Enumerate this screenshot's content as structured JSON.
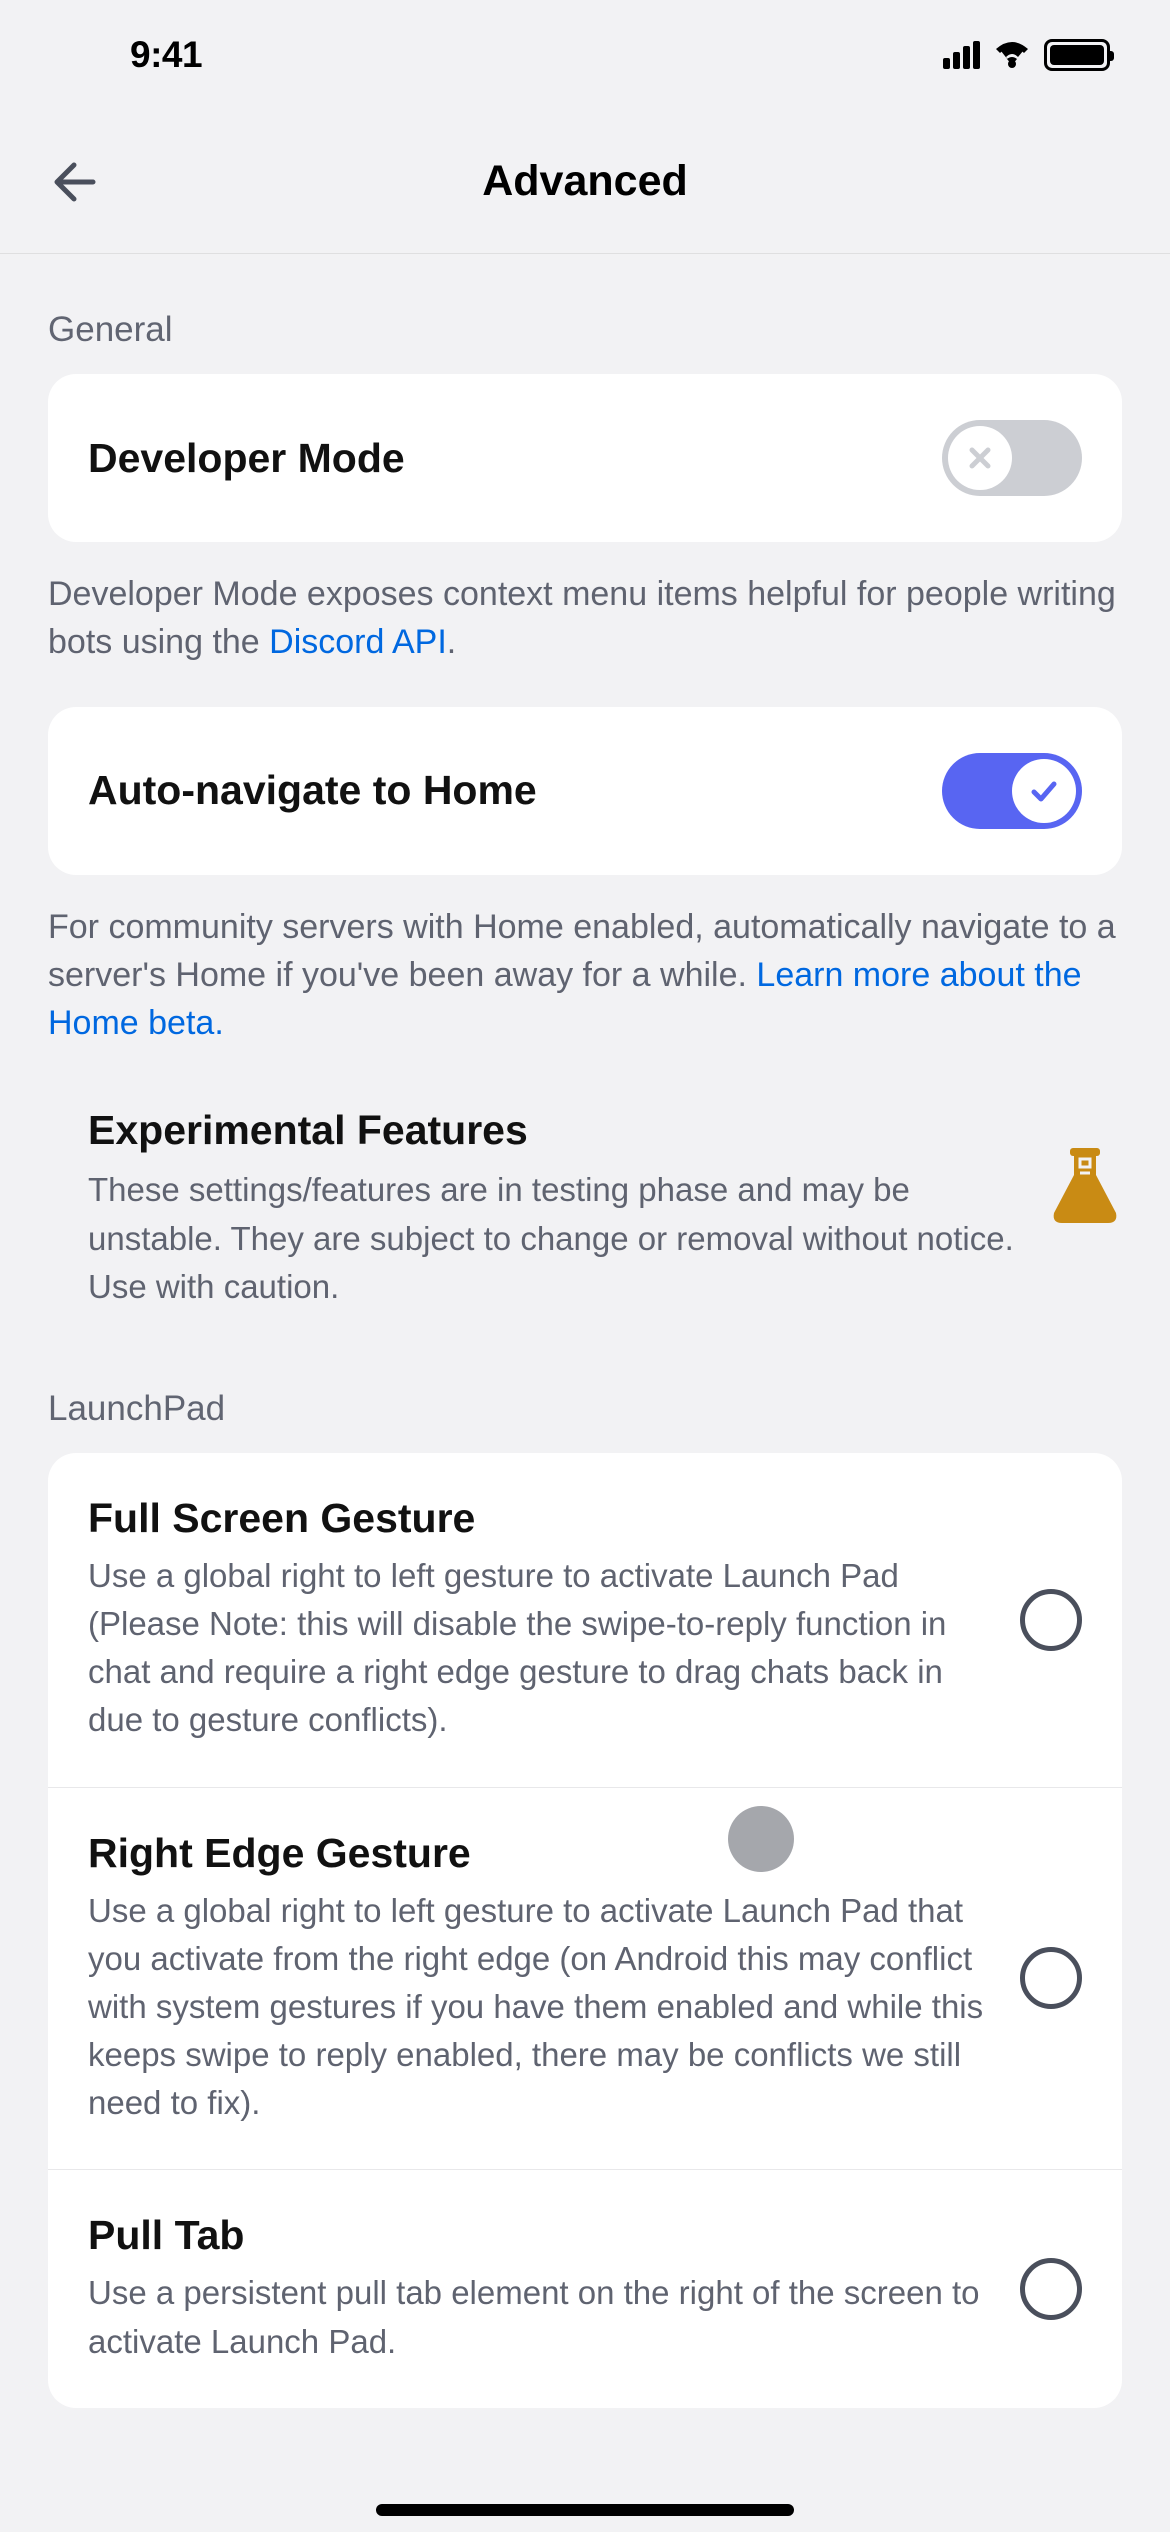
{
  "status": {
    "time": "9:41"
  },
  "nav": {
    "title": "Advanced"
  },
  "sections": {
    "general": {
      "header": "General",
      "items": [
        {
          "label": "Developer Mode",
          "enabled": false,
          "description": "Developer Mode exposes context menu items helpful for people writing bots using the ",
          "link_text": "Discord API",
          "description_suffix": "."
        },
        {
          "label": "Auto-navigate to Home",
          "enabled": true,
          "description": "For community servers with Home enabled, automatically navigate to a server's Home if you've been away for a while. ",
          "link_text": "Learn more about the Home beta.",
          "description_suffix": ""
        }
      ]
    },
    "experimental": {
      "title": "Experimental Features",
      "description": "These settings/features are in testing phase and may be unstable. They are subject to change or removal without notice. Use with caution."
    },
    "launchpad": {
      "header": "LaunchPad",
      "options": [
        {
          "title": "Full Screen Gesture",
          "description": "Use a global right to left gesture to activate Launch Pad (Please Note: this will disable the swipe-to-reply function in chat and require a right edge gesture to drag chats back in due to gesture conflicts).",
          "selected": false
        },
        {
          "title": "Right Edge Gesture",
          "description": "Use a global right to left gesture to activate Launch Pad that you activate from the right edge (on Android this may conflict with system gestures if you have them enabled and while this keeps swipe to reply enabled, there may be conflicts we still need to fix).",
          "selected": false
        },
        {
          "title": "Pull Tab",
          "description": "Use a persistent pull tab element on the right of the screen to activate Launch Pad.",
          "selected": false
        }
      ]
    }
  }
}
